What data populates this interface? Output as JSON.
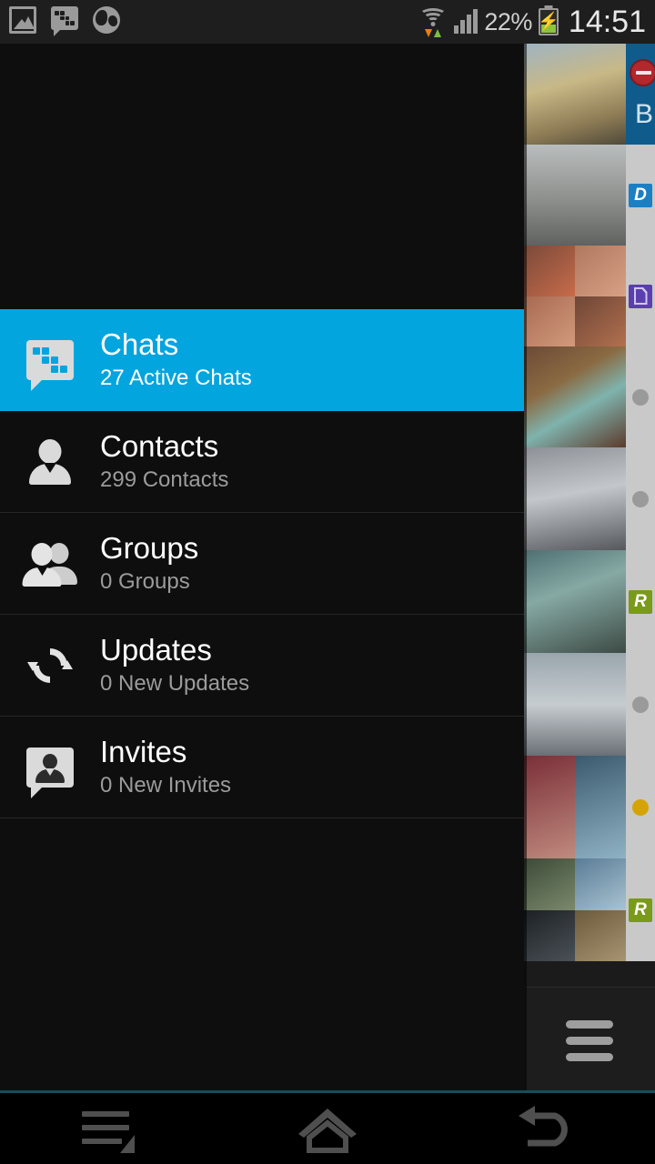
{
  "statusbar": {
    "icons_left": [
      "picture-icon",
      "bbm-icon",
      "globe-icon"
    ],
    "wifi": "wifi-icon",
    "data_arrows": "data-transfer-icon",
    "signal": "signal-bars-icon",
    "battery_percent": "22%",
    "battery": "charging-battery-icon",
    "clock": "14:51"
  },
  "drawer": {
    "items": [
      {
        "title": "Chats",
        "subtitle": "27 Active Chats",
        "icon": "bbm-chat-icon",
        "active": true
      },
      {
        "title": "Contacts",
        "subtitle": "299 Contacts",
        "icon": "person-icon",
        "active": false
      },
      {
        "title": "Groups",
        "subtitle": "0 Groups",
        "icon": "group-icon",
        "active": false
      },
      {
        "title": "Updates",
        "subtitle": "0 New Updates",
        "icon": "sync-icon",
        "active": false
      },
      {
        "title": "Invites",
        "subtitle": "0 New Invites",
        "icon": "invite-icon",
        "active": false
      }
    ]
  },
  "panel": {
    "rows": [
      {
        "height": 111,
        "tiles": 1,
        "indicator": "selected",
        "letter": "B",
        "icon": "no-entry-icon"
      },
      {
        "height": 111,
        "tiles": 1,
        "indicator": "badge-blue",
        "letter": "D"
      },
      {
        "height": 111,
        "tiles": 4,
        "indicator": "badge-purple",
        "letter": "",
        "icon": "document-icon"
      },
      {
        "height": 111,
        "tiles": 1,
        "indicator": "dot-grey",
        "letter": ""
      },
      {
        "height": 113,
        "tiles": 1,
        "indicator": "dot-grey",
        "letter": ""
      },
      {
        "height": 113,
        "tiles": 1,
        "indicator": "badge-green",
        "letter": "R"
      },
      {
        "height": 113,
        "tiles": 1,
        "indicator": "dot-grey",
        "letter": ""
      },
      {
        "height": 113,
        "tiles": 2,
        "indicator": "dot-amber",
        "letter": ""
      },
      {
        "height": 113,
        "tiles": 4,
        "indicator": "badge-green",
        "letter": "R"
      }
    ],
    "footer_icon": "hamburger-menu-icon"
  },
  "navbar": {
    "menu": "menu-icon",
    "home": "home-icon",
    "back": "back-icon"
  },
  "colors": {
    "accent": "#02a5de",
    "selected_row": "#0f5b8c",
    "badge_blue": "#1b7fc4",
    "badge_purple": "#5b3fae",
    "badge_green": "#7a9a1a",
    "dot_amber": "#d4a407",
    "dot_grey": "#9a9a9a",
    "drawer_bg": "#0e0e0e",
    "statusbar_bg": "#1e1e1e"
  }
}
